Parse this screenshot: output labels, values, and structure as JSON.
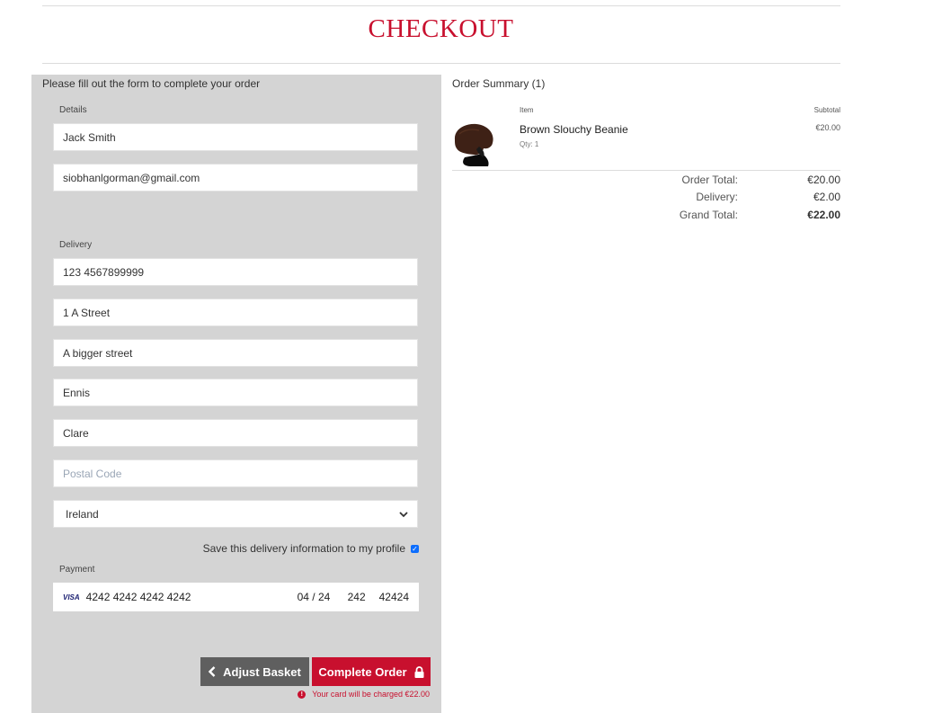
{
  "page": {
    "title": "CHECKOUT"
  },
  "form": {
    "intro": "Please fill out the form to complete your order",
    "details_label": "Details",
    "full_name": "Jack Smith",
    "email": "siobhanlgorman@gmail.com",
    "delivery_label": "Delivery",
    "phone": "123 4567899999",
    "street1": "1 A Street",
    "street2": "A bigger street",
    "town": "Ennis",
    "county": "Clare",
    "postcode_placeholder": "Postal Code",
    "country": "Ireland",
    "save_info_label": "Save this delivery information to my profile",
    "save_info_checked": true,
    "payment_label": "Payment",
    "card": {
      "brand": "VISA",
      "number": "4242 4242 4242 4242",
      "expiry": "04 / 24",
      "cvc": "242",
      "zip": "42424"
    },
    "adjust_label": "Adjust Basket",
    "complete_label": "Complete Order",
    "charge_note": "Your card will be charged €22.00"
  },
  "summary": {
    "title": "Order Summary (1)",
    "col_item": "Item",
    "col_subtotal": "Subtotal",
    "items": [
      {
        "name": "Brown Slouchy Beanie",
        "qty": "Qty: 1",
        "subtotal": "€20.00"
      }
    ],
    "order_total_label": "Order Total:",
    "order_total": "€20.00",
    "delivery_label": "Delivery:",
    "delivery": "€2.00",
    "grand_total_label": "Grand Total:",
    "grand_total": "€22.00"
  },
  "colors": {
    "brand": "#c8102e",
    "panel": "#d4d4d4",
    "button_dark": "#5f5f5f"
  },
  "icons": [
    "chevron-left-icon",
    "lock-icon",
    "alert-circle-icon",
    "chevron-down-icon",
    "visa-icon",
    "checkbox-icon"
  ]
}
